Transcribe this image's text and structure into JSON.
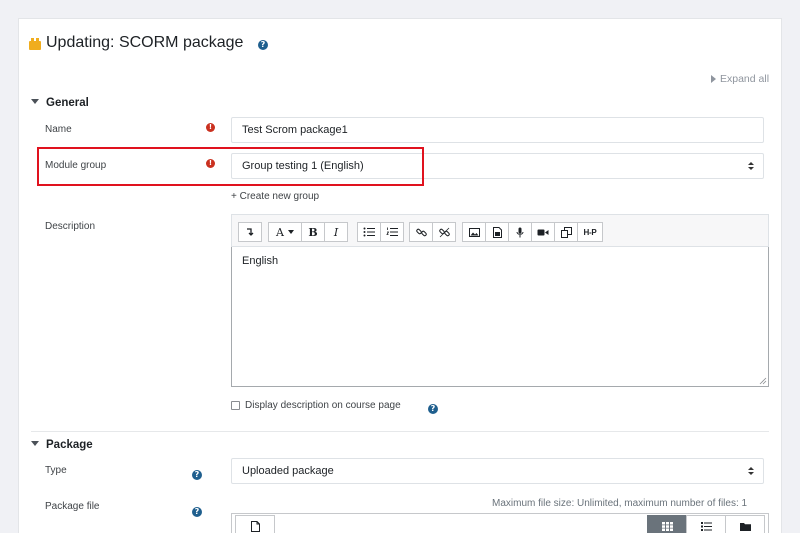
{
  "page": {
    "title": "Updating: SCORM package",
    "expand_all": "Expand all"
  },
  "general": {
    "header": "General",
    "name_label": "Name",
    "name_value": "Test Scrom package1",
    "module_group_label": "Module group",
    "module_group_value": "Group testing 1 (English)",
    "create_new_group": "+ Create new group",
    "description_label": "Description",
    "description_text": "English",
    "display_description": "Display description on course page"
  },
  "toolbar": {
    "h5p_label": "H-P",
    "font_label": "A",
    "bold_label": "B",
    "italic_label": "I"
  },
  "package": {
    "header": "Package",
    "type_label": "Type",
    "type_value": "Uploaded package",
    "file_label": "Package file",
    "max_size": "Maximum file size: Unlimited, maximum number of files: 1"
  },
  "colors": {
    "help_icon": "#1f5f8e",
    "required_icon": "#ca3120",
    "highlight_box": "#e0121e",
    "active_view": "#6a737b"
  }
}
